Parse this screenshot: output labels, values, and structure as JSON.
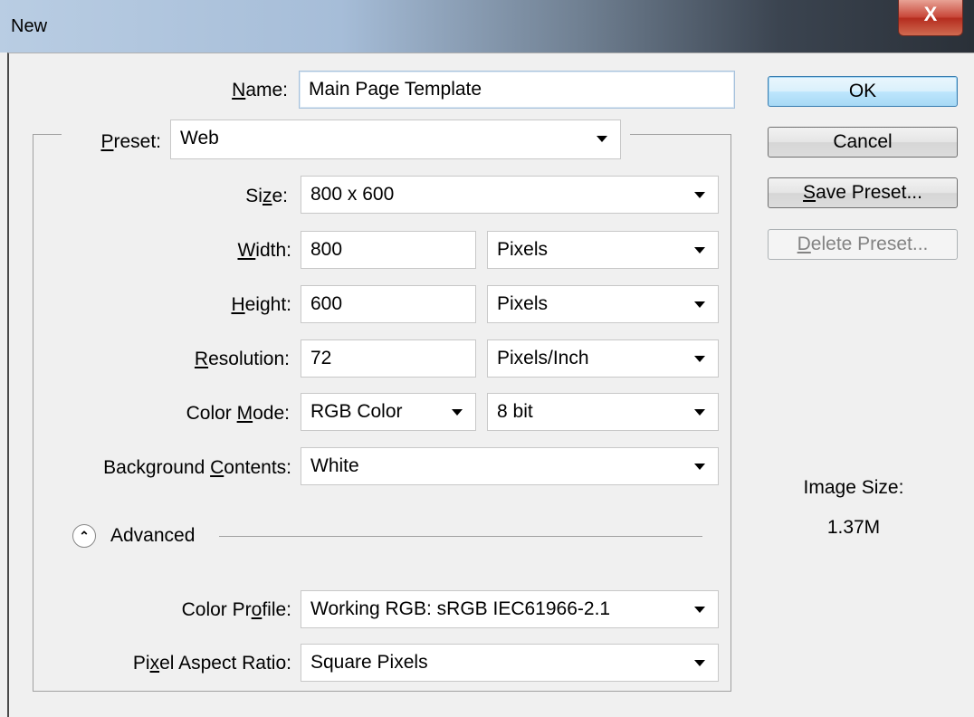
{
  "window": {
    "title": "New",
    "close_label": "X"
  },
  "name": {
    "label": "Name:",
    "value": "Main Page Template"
  },
  "preset": {
    "label": "Preset:",
    "value": "Web"
  },
  "size": {
    "label": "Size:",
    "value": "800 x 600"
  },
  "width": {
    "label": "Width:",
    "value": "800",
    "unit": "Pixels"
  },
  "height": {
    "label": "Height:",
    "value": "600",
    "unit": "Pixels"
  },
  "resolution": {
    "label": "Resolution:",
    "value": "72",
    "unit": "Pixels/Inch"
  },
  "color_mode": {
    "label": "Color Mode:",
    "value": "RGB Color",
    "depth": "8 bit"
  },
  "background": {
    "label": "Background Contents:",
    "value": "White"
  },
  "advanced": {
    "label": "Advanced"
  },
  "color_profile": {
    "label": "Color Profile:",
    "value": "Working RGB:  sRGB IEC61966-2.1"
  },
  "pixel_aspect": {
    "label": "Pixel Aspect Ratio:",
    "value": "Square Pixels"
  },
  "buttons": {
    "ok": "OK",
    "cancel": "Cancel",
    "save_preset": "Save Preset...",
    "delete_preset": "Delete Preset..."
  },
  "image_size": {
    "label": "Image Size:",
    "value": "1.37M"
  }
}
